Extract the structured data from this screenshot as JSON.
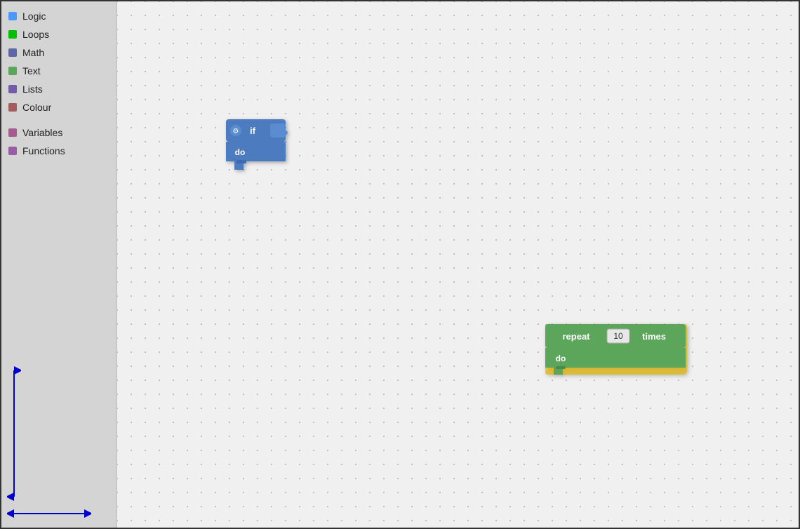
{
  "sidebar": {
    "items": [
      {
        "label": "Logic",
        "color": "#4C97FF",
        "id": "logic"
      },
      {
        "label": "Loops",
        "color": "#00BF00",
        "id": "loops"
      },
      {
        "label": "Math",
        "color": "#5C68A6",
        "id": "math"
      },
      {
        "label": "Text",
        "color": "#5CA65C",
        "id": "text"
      },
      {
        "label": "Lists",
        "color": "#745CA6",
        "id": "lists"
      },
      {
        "label": "Colour",
        "color": "#A65C5C",
        "id": "colour"
      },
      {
        "label": "Variables",
        "color": "#A65C91",
        "id": "variables"
      },
      {
        "label": "Functions",
        "color": "#9A5CA6",
        "id": "functions"
      }
    ]
  },
  "blocks": {
    "if_block": {
      "top_label": "if",
      "bottom_label": "do",
      "gear_icon": "⚙"
    },
    "repeat_block": {
      "repeat_label": "repeat",
      "times_label": "times",
      "do_label": "do",
      "value": "10"
    }
  }
}
